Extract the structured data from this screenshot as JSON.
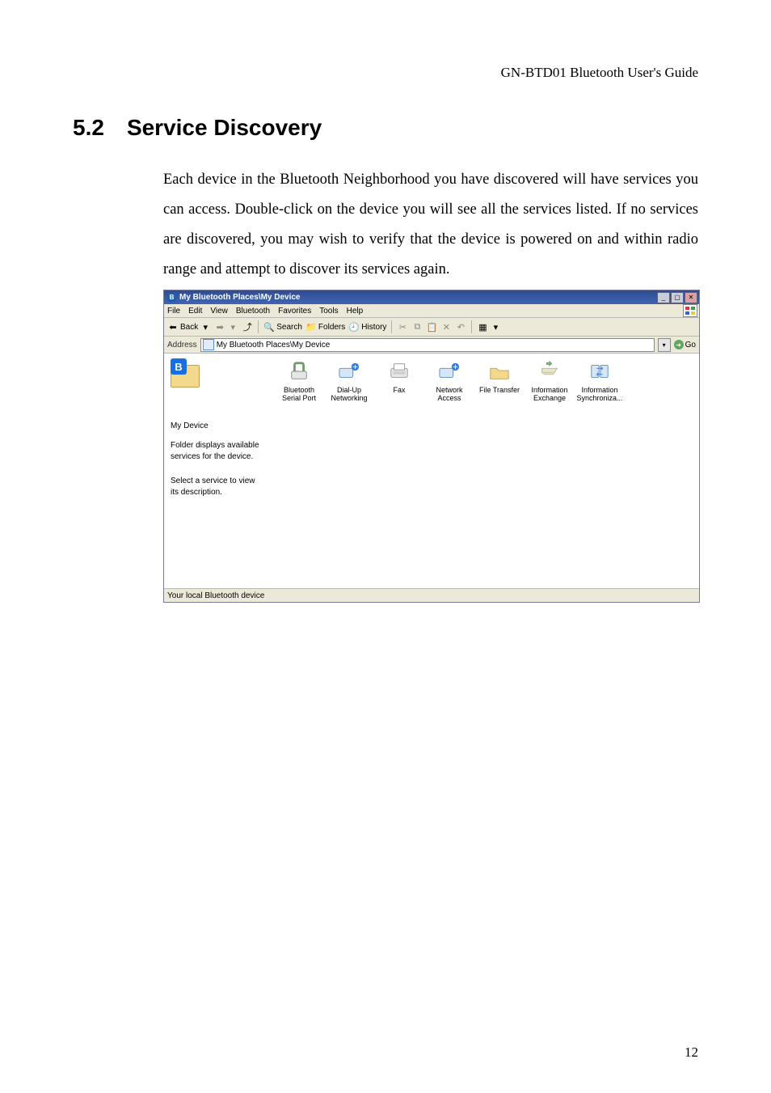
{
  "product_header": "GN-BTD01 Bluetooth User's Guide",
  "section": {
    "num": "5.2",
    "title": "Service Discovery"
  },
  "paragraph": "Each device in the Bluetooth Neighborhood you have discovered will have services you can access. Double-click on the device you will see all the services listed. If no services are discovered, you may wish to verify that the device is powered on and within radio range and attempt to discover its services again.",
  "window": {
    "title": "My Bluetooth Places\\My Device",
    "menu": [
      "File",
      "Edit",
      "View",
      "Bluetooth",
      "Favorites",
      "Tools",
      "Help"
    ],
    "toolbar": {
      "back": "Back",
      "search": "Search",
      "folders": "Folders",
      "history": "History"
    },
    "addressbar": {
      "label": "Address",
      "value": "My Bluetooth Places\\My Device",
      "go": "Go"
    },
    "left_panel": {
      "device_name": "My Device",
      "desc": "Folder displays available services for the device.",
      "hint": "Select a service to view its description."
    },
    "services": [
      {
        "label": "Bluetooth Serial Port"
      },
      {
        "label": "Dial-Up Networking"
      },
      {
        "label": "Fax"
      },
      {
        "label": "Network Access"
      },
      {
        "label": "File Transfer"
      },
      {
        "label": "Information Exchange"
      },
      {
        "label": "Information Synchroniza..."
      }
    ],
    "statusbar": "Your local Bluetooth device"
  },
  "page_number": "12",
  "icons": {
    "bt_glyph": "⁕",
    "back_arrow": "⬅",
    "fwd_arrow": "➡",
    "up": "⤴",
    "search": "🔍",
    "folders": "📁",
    "history": "🕘",
    "cut": "✂",
    "copy": "⧉",
    "paste": "📋",
    "delete": "✕",
    "undo": "↶",
    "views": "▦",
    "dropdown": "▾",
    "go_arrow": "➜"
  }
}
